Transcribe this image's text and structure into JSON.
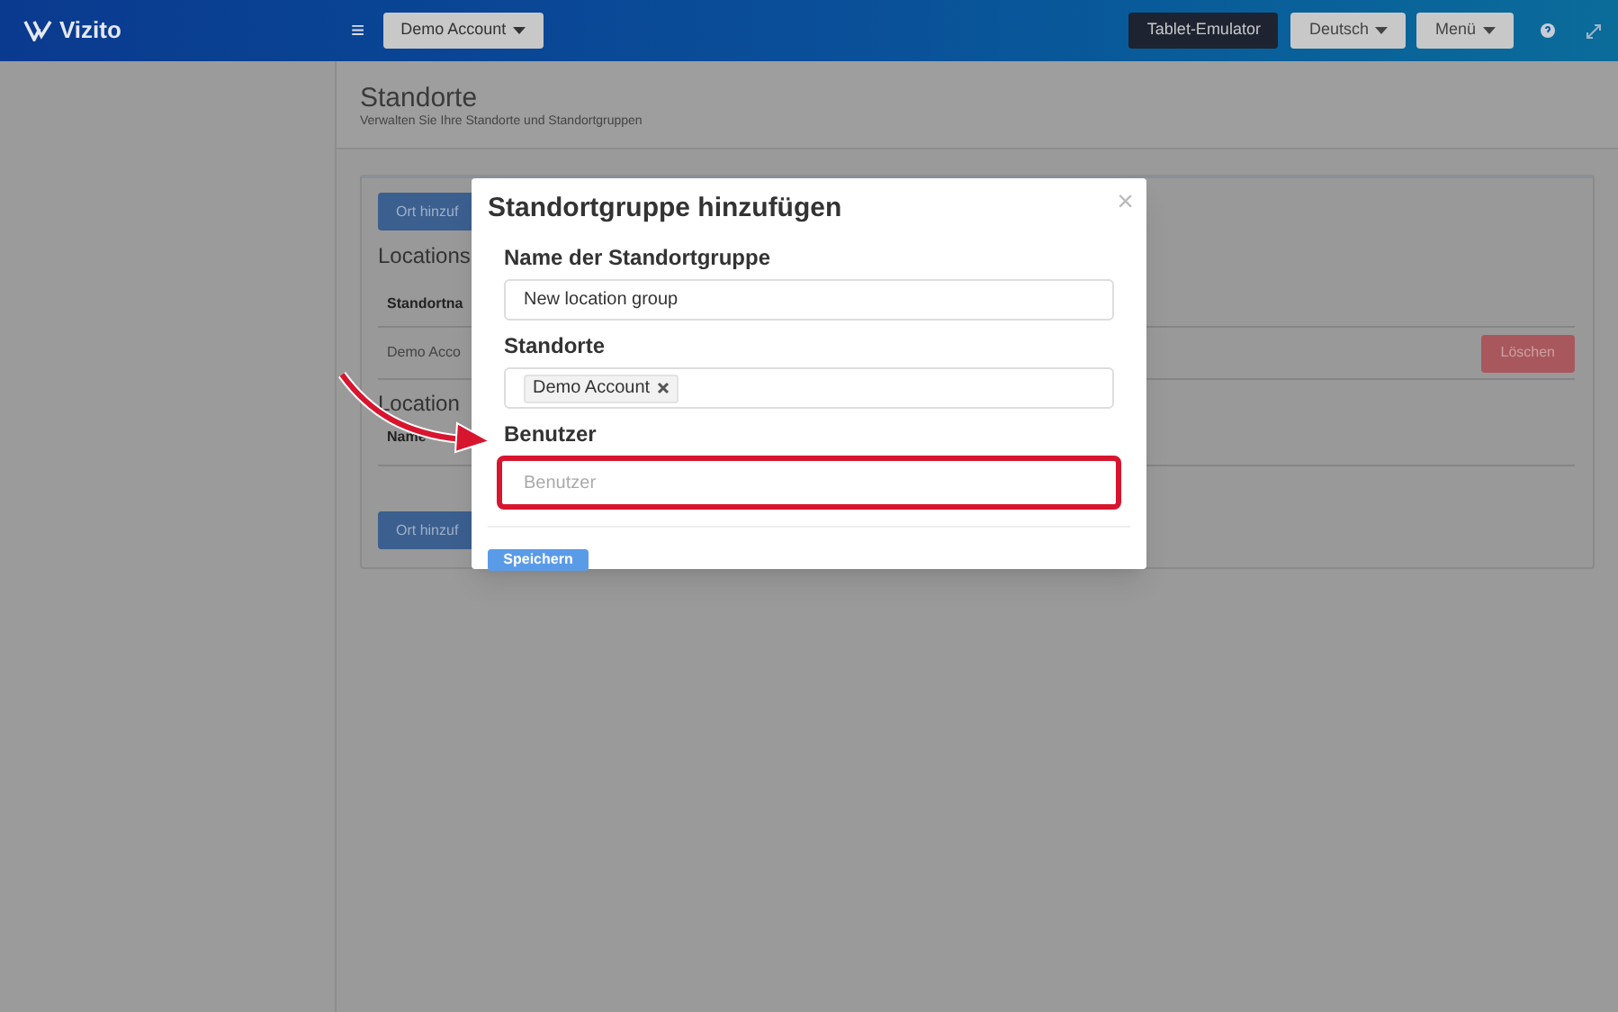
{
  "header": {
    "logo": "Vizito",
    "menu_icon": "≡",
    "account_button": "Demo Account",
    "tablet_button": "Tablet-Emulator",
    "language_button": "Deutsch",
    "menu_button": "Menü"
  },
  "page": {
    "title": "Standorte",
    "subtitle": "Verwalten Sie Ihre Standorte und Standortgruppen"
  },
  "card": {
    "add_button_top": "Ort hinzuf",
    "locations_heading": "Locations",
    "locations_column": "Standortna",
    "location_row": "Demo Acco",
    "delete_button": "Löschen",
    "groups_heading": "Location",
    "groups_column": "Name",
    "add_button_bottom": "Ort hinzuf"
  },
  "modal": {
    "title": "Standortgruppe hinzufügen",
    "close": "×",
    "fields": [
      {
        "kind": "text",
        "label": "Name der Standortgruppe",
        "value": "New location group",
        "highlighted": false
      },
      {
        "kind": "tags",
        "label": "Standorte",
        "tags": [
          "Demo Account"
        ],
        "highlighted": false
      },
      {
        "kind": "text",
        "label": "Benutzer",
        "placeholder": "Benutzer",
        "highlighted": true
      }
    ],
    "save_button": "Speichern"
  }
}
